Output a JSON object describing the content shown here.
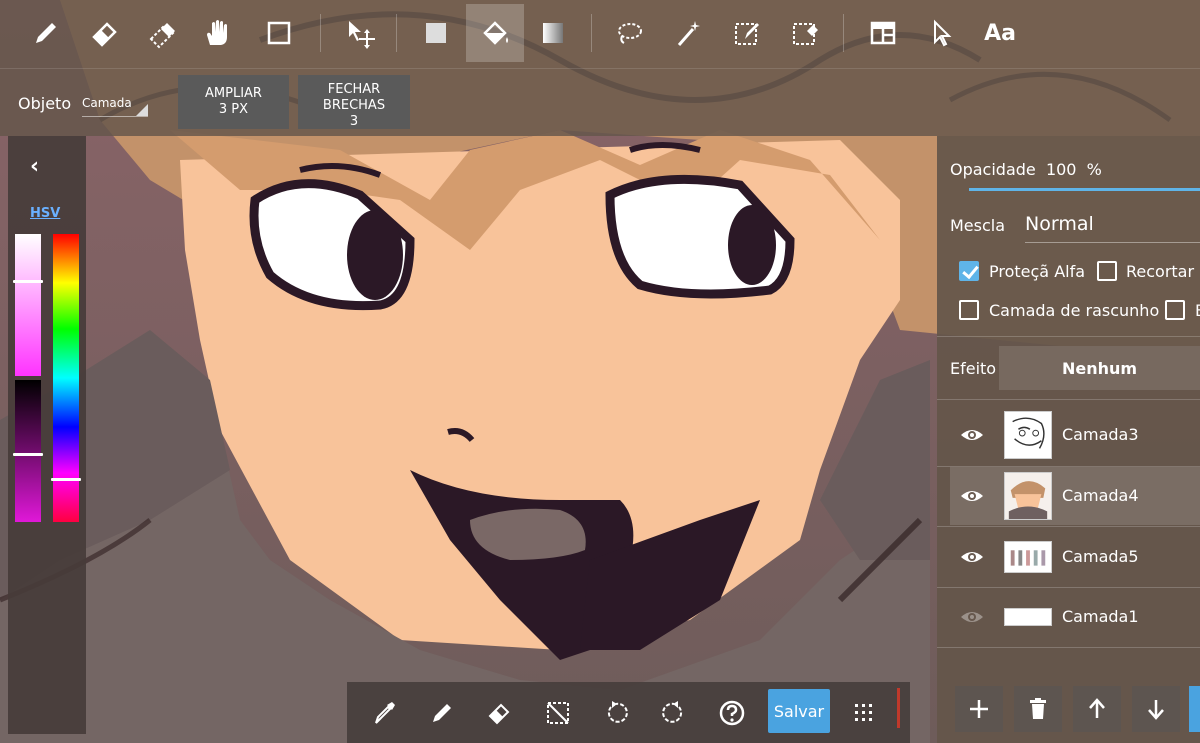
{
  "toolbar": {
    "tools": [
      {
        "name": "pen-icon"
      },
      {
        "name": "eraser-icon"
      },
      {
        "name": "blur-eraser-icon"
      },
      {
        "name": "hand-icon"
      },
      {
        "name": "rectangle-icon"
      },
      {
        "name": "move-icon"
      },
      {
        "name": "fill-square-icon"
      },
      {
        "name": "bucket-icon",
        "active": true
      },
      {
        "name": "gradient-icon"
      },
      {
        "name": "lasso-icon"
      },
      {
        "name": "magic-wand-icon"
      },
      {
        "name": "select-pen-icon"
      },
      {
        "name": "select-eraser-icon"
      },
      {
        "name": "panel-icon"
      },
      {
        "name": "cursor-icon"
      }
    ],
    "text_tool_label": "Aa"
  },
  "options": {
    "object_label": "Objeto",
    "object_value": "Camada",
    "expand_button": "AMPLIAR\n3 PX",
    "close_gaps_button": "FECHAR\nBRECHAS\n3"
  },
  "color_panel": {
    "back_glyph": "‹",
    "mode": "HSV",
    "saturation_level": 0.33,
    "value_level": 0.52,
    "hue_level": 0.85
  },
  "layer_panel": {
    "opacity_label": "Opacidade",
    "opacity_value": "100",
    "opacity_unit": "%",
    "blend_label": "Mescla",
    "blend_value": "Normal",
    "alpha_protect_label": "Proteçã Alfa",
    "alpha_protect_checked": true,
    "clip_label": "Recortar",
    "clip_checked": false,
    "draft_label": "Camada de rascunho",
    "draft_checked": false,
    "extra_label": "B",
    "effect_label": "Efeito",
    "effect_value": "Nenhum",
    "layers": [
      {
        "name": "Camada3",
        "visible": true,
        "selected": false
      },
      {
        "name": "Camada4",
        "visible": true,
        "selected": true
      },
      {
        "name": "Camada5",
        "visible": true,
        "selected": false
      },
      {
        "name": "Camada1",
        "visible": false,
        "selected": false
      }
    ],
    "actions": [
      "add-layer-icon",
      "delete-layer-icon",
      "move-up-icon",
      "move-down-icon"
    ]
  },
  "bottom_bar": {
    "tools": [
      "eyedropper-icon",
      "pen-icon",
      "eraser-icon",
      "deselect-icon",
      "undo-icon",
      "redo-icon",
      "help-icon"
    ],
    "save_label": "Salvar",
    "menu_icon": "grid-menu-icon"
  },
  "colors": {
    "accent": "#4aa3e0",
    "skin": "#f8c39a",
    "hair": "#c79468",
    "outline": "#2b1826"
  }
}
